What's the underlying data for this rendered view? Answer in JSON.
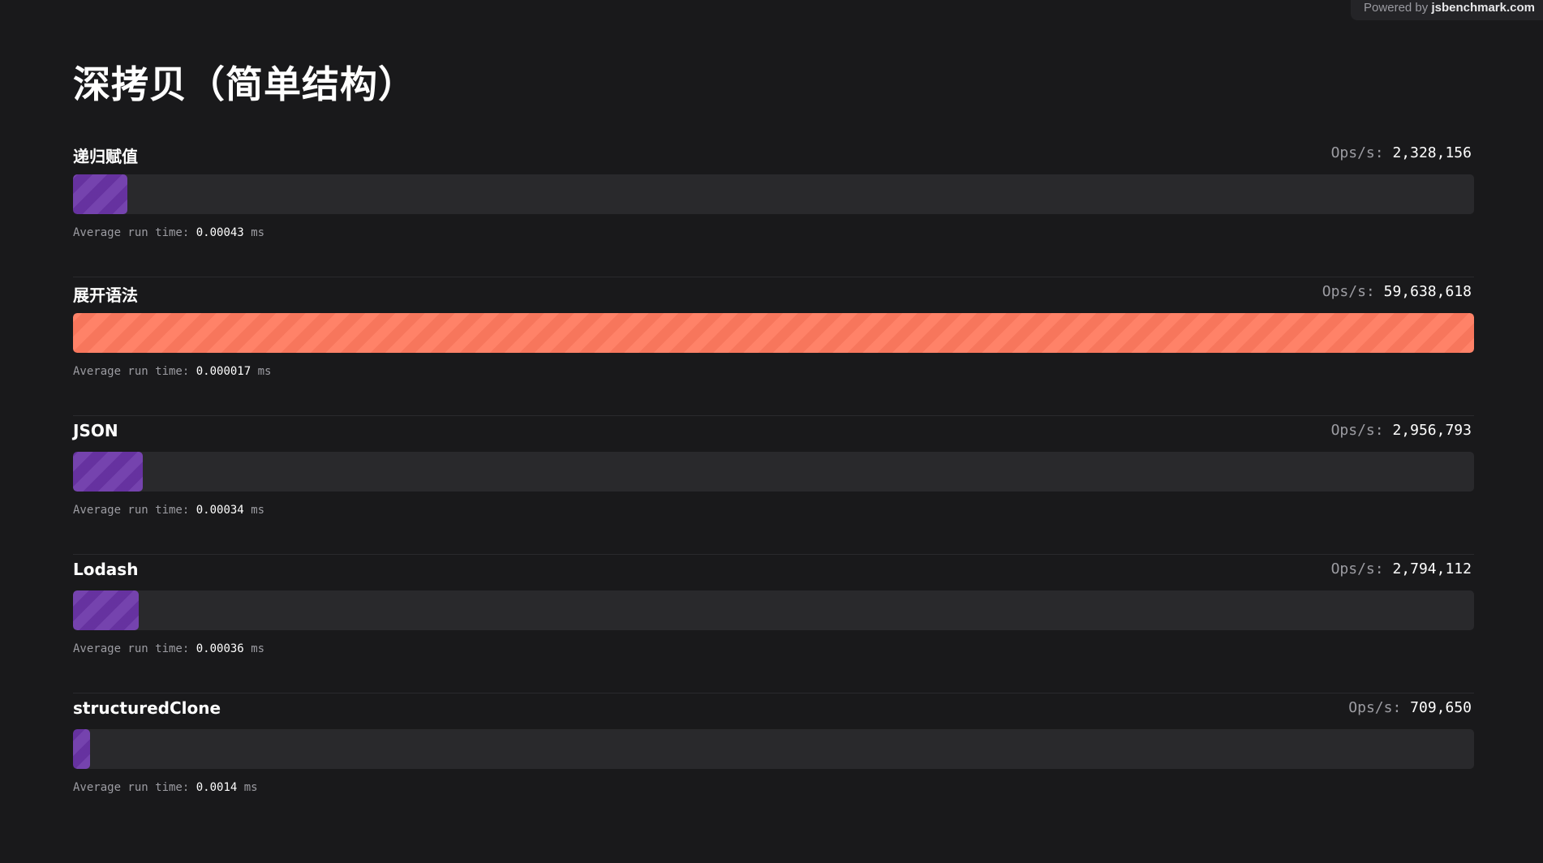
{
  "powered_by": {
    "prefix": "Powered by",
    "brand": "jsbenchmark.com"
  },
  "title": "深拷贝（简单结构）",
  "labels": {
    "ops": "Ops/s:",
    "avg": "Average run time:",
    "unit": "ms"
  },
  "colors": {
    "background": "#19191b",
    "bar": "#6b35a8",
    "fastest_bar": "#ff7a5f",
    "track": "#29292c"
  },
  "results": [
    {
      "name": "递归赋值",
      "ops": "2,328,156",
      "avg_time": "0.00043",
      "relative": 0.039,
      "fastest": false
    },
    {
      "name": "展开语法",
      "ops": "59,638,618",
      "avg_time": "0.000017",
      "relative": 1.0,
      "fastest": true
    },
    {
      "name": "JSON",
      "ops": "2,956,793",
      "avg_time": "0.00034",
      "relative": 0.0496,
      "fastest": false
    },
    {
      "name": "Lodash",
      "ops": "2,794,112",
      "avg_time": "0.00036",
      "relative": 0.0469,
      "fastest": false
    },
    {
      "name": "structuredClone",
      "ops": "709,650",
      "avg_time": "0.0014",
      "relative": 0.0119,
      "fastest": false
    }
  ]
}
